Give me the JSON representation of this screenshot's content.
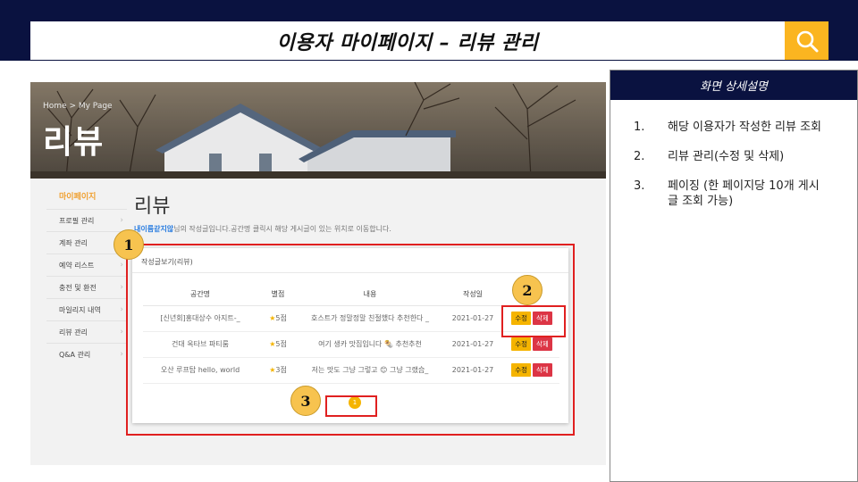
{
  "slide": {
    "title": "이용자 마이페이지 – 리뷰 관리",
    "search_icon": "search-icon",
    "accent": "#fbb520",
    "navy": "#0a1240"
  },
  "screenshot": {
    "hero": {
      "breadcrumb": "Home > My Page",
      "title": "리뷰"
    },
    "sidebar": {
      "heading": "마이페이지",
      "items": [
        {
          "label": "프로필 관리"
        },
        {
          "label": "계좌 관리"
        },
        {
          "label": "예약 리스트"
        },
        {
          "label": "충전 및 환전"
        },
        {
          "label": "마일리지 내역"
        },
        {
          "label": "리뷰 관리"
        },
        {
          "label": "Q&A 관리"
        }
      ]
    },
    "page_title": "리뷰",
    "notice": {
      "nickname": "내이름같지않",
      "text": "님의 작성글입니다.공간명 클릭시 해당 게시글이 있는 위치로 이동합니다."
    },
    "card": {
      "heading": "작성글보기(리뷰)",
      "columns": [
        "공간명",
        "별점",
        "내용",
        "작성일",
        ""
      ],
      "rows": [
        {
          "space": "[신년회]홍대상수 아지트-_",
          "rating": "5점",
          "content": "호스트가 정말정말 친절했다 추천한다 _",
          "date": "2021-01-27",
          "edit": "수정",
          "delete": "삭제"
        },
        {
          "space": "건대 옥타브 파티룸",
          "rating": "5점",
          "content": "여기 생카 맛집입니다 🌯 추천추천",
          "date": "2021-01-27",
          "edit": "수정",
          "delete": "삭제"
        },
        {
          "space": "오산 루프탑 hello, world",
          "rating": "3점",
          "content": "저는 맛도 그냥 그렇고 😊 그냥 그랬습_",
          "date": "2021-01-27",
          "edit": "수정",
          "delete": "삭제"
        }
      ],
      "pagination": [
        "1"
      ]
    }
  },
  "annotations": {
    "markers": [
      "1",
      "2",
      "3"
    ]
  },
  "panel": {
    "title": "화면 상세설명",
    "items": [
      {
        "num": "1.",
        "text": "해당 이용자가 작성한 리뷰 조회"
      },
      {
        "num": "2.",
        "text": "리뷰 관리(수정 및 삭제)"
      },
      {
        "num": "3.",
        "text": "페이징 (한 페이지당 10개 게시글 조회 가능)"
      }
    ]
  }
}
